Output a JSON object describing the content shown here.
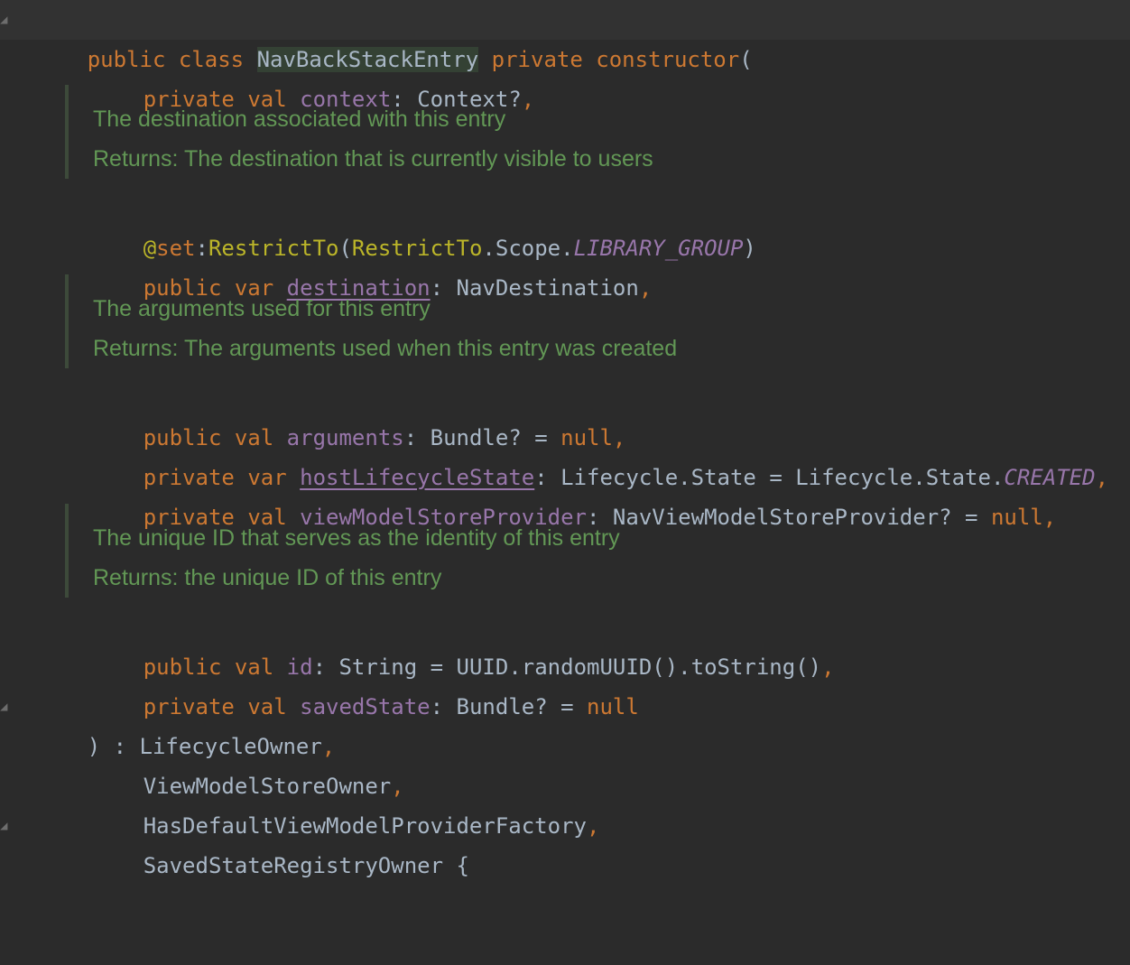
{
  "editor": {
    "line1": {
      "kw_public": "public",
      "kw_class": "class",
      "class_name": "NavBackStackEntry",
      "kw_private": "private",
      "kw_constructor": "constructor",
      "paren": "("
    },
    "line2": {
      "kw_private": "private",
      "kw_val": "val",
      "name": "context",
      "colon": ": ",
      "type": "Context?",
      "comma": ","
    },
    "doc1": {
      "line1": "The destination associated with this entry",
      "line2": "Returns: The destination that is currently visible to users"
    },
    "line_annotation": {
      "at": "@",
      "set": "set",
      "colon": ":",
      "ann": "RestrictTo",
      "open": "(",
      "ann2": "RestrictTo",
      "scope": ".Scope.",
      "const": "LIBRARY_GROUP",
      "close": ")"
    },
    "line_destination": {
      "kw_public": "public",
      "kw_var": "var",
      "name": "destination",
      "colon": ": ",
      "type": "NavDestination",
      "comma": ","
    },
    "doc2": {
      "line1": "The arguments used for this entry",
      "line2": "Returns: The arguments used when this entry was created"
    },
    "line_arguments": {
      "kw_public": "public",
      "kw_val": "val",
      "name": "arguments",
      "colon": ": ",
      "type": "Bundle? = ",
      "null": "null",
      "comma": ","
    },
    "line_host": {
      "kw_private": "private",
      "kw_var": "var",
      "name": "hostLifecycleState",
      "colon": ": ",
      "type": "Lifecycle.State = Lifecycle.State.",
      "const": "CREATED",
      "comma": ","
    },
    "line_vmsp": {
      "kw_private": "private",
      "kw_val": "val",
      "name": "viewModelStoreProvider",
      "colon": ": ",
      "type": "NavViewModelStoreProvider? = ",
      "null": "null",
      "comma": ","
    },
    "doc3": {
      "line1": "The unique ID that serves as the identity of this entry",
      "line2": "Returns: the unique ID of this entry"
    },
    "line_id": {
      "kw_public": "public",
      "kw_val": "val",
      "name": "id",
      "colon": ": ",
      "type": "String = UUID.randomUUID().toString()",
      "comma": ","
    },
    "line_saved": {
      "kw_private": "private",
      "kw_val": "val",
      "name": "savedState",
      "colon": ": ",
      "type": "Bundle? = ",
      "null": "null"
    },
    "line_close": {
      "text": ") : LifecycleOwner",
      "comma": ","
    },
    "line_vmso": {
      "text": "ViewModelStoreOwner",
      "comma": ","
    },
    "line_hdvmpf": {
      "text": "HasDefaultViewModelProviderFactory",
      "comma": ","
    },
    "line_ssro": {
      "text": "SavedStateRegistryOwner {"
    }
  }
}
